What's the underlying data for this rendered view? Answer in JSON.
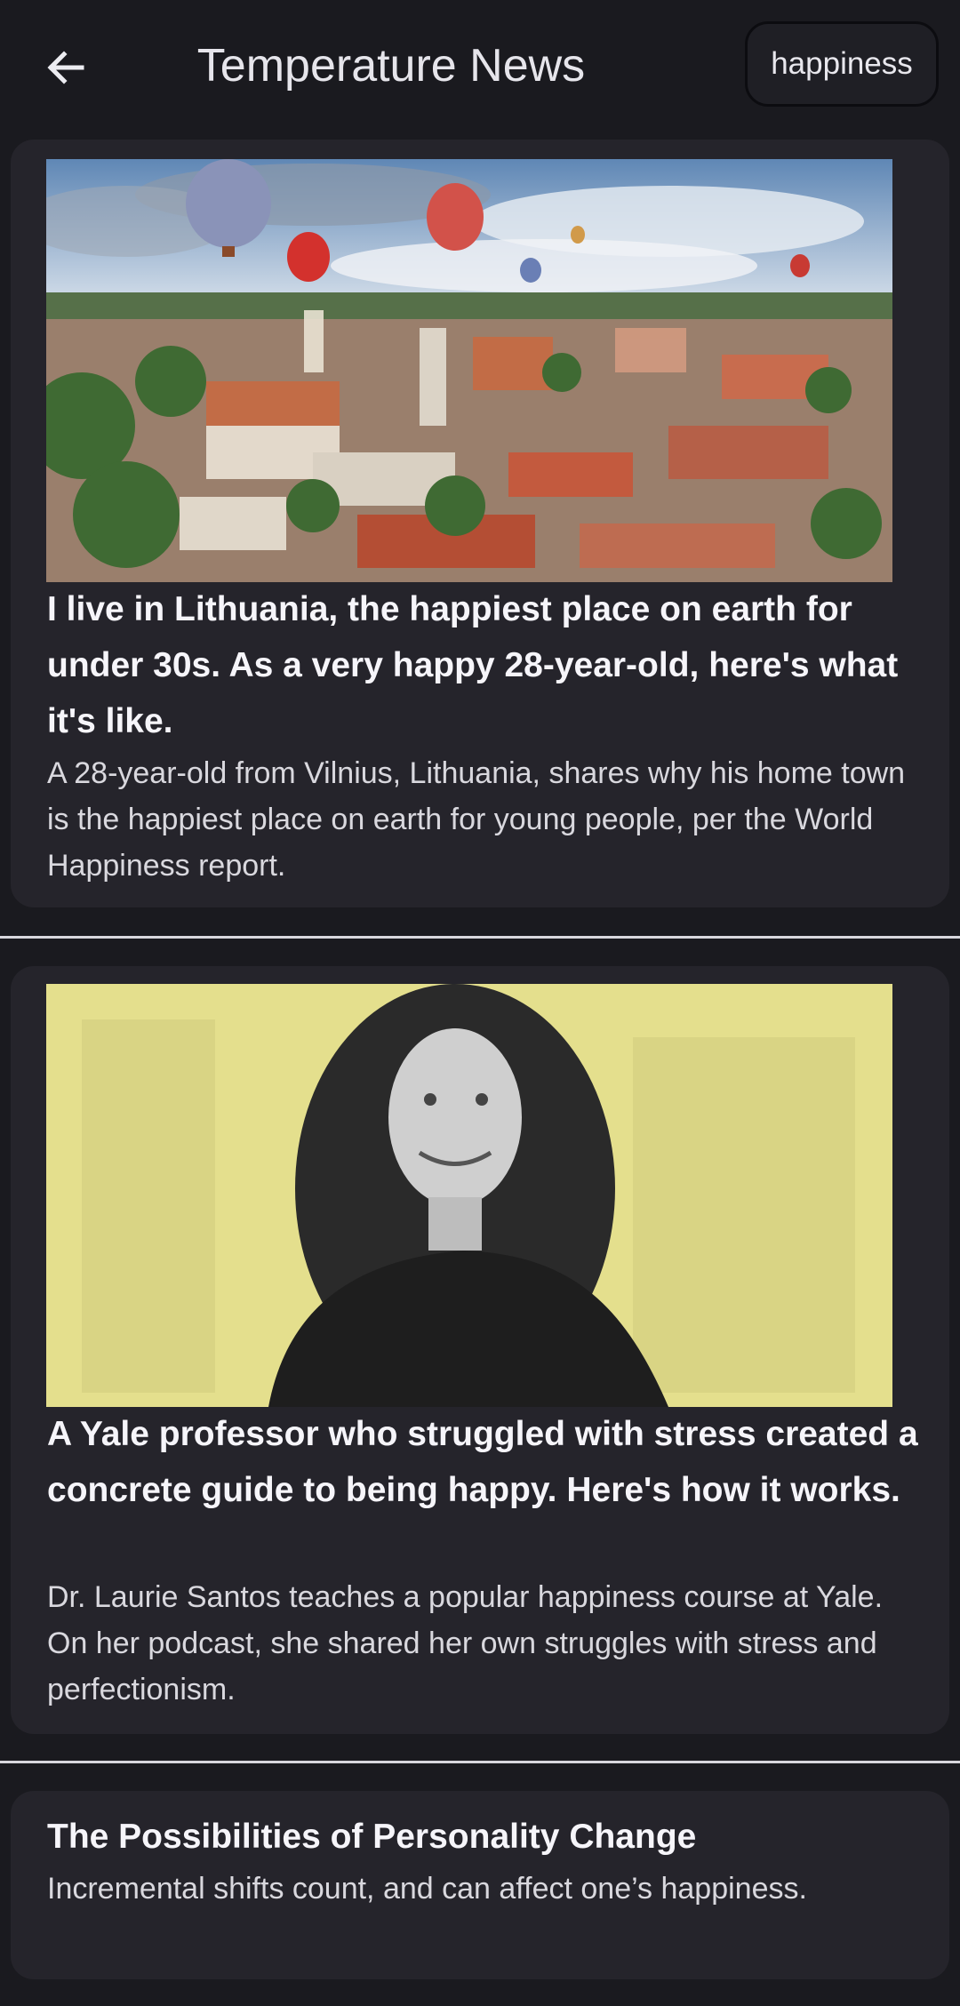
{
  "appbar": {
    "title": "Temperature News",
    "search_chip": "happiness",
    "back_icon": "arrow-left-icon"
  },
  "articles": [
    {
      "image_icon": "hot-air-balloons-over-city-photo",
      "title": "I live in Lithuania, the happiest place on earth for under 30s. As a very happy 28-year-old, here's what it's like.",
      "description": "A 28-year-old from Vilnius, Lithuania, shares why his home town is the happiest place on earth for young people, per the World Happiness report."
    },
    {
      "image_icon": "woman-portrait-yellow-background-photo",
      "title": "A Yale professor who struggled with stress created a concrete guide to being happy. Here's how it works.",
      "description": "Dr. Laurie Santos teaches a popular happiness course at Yale. On her podcast, she shared her own struggles with stress and perfectionism."
    },
    {
      "title": "The Possibilities of Personality Change",
      "description": "Incremental shifts count, and can affect one’s happiness."
    }
  ],
  "colors": {
    "background": "#1a1a1f",
    "card": "#25242b",
    "divider": "#d8d7dd",
    "photo_yellow": "#e4df8d"
  }
}
